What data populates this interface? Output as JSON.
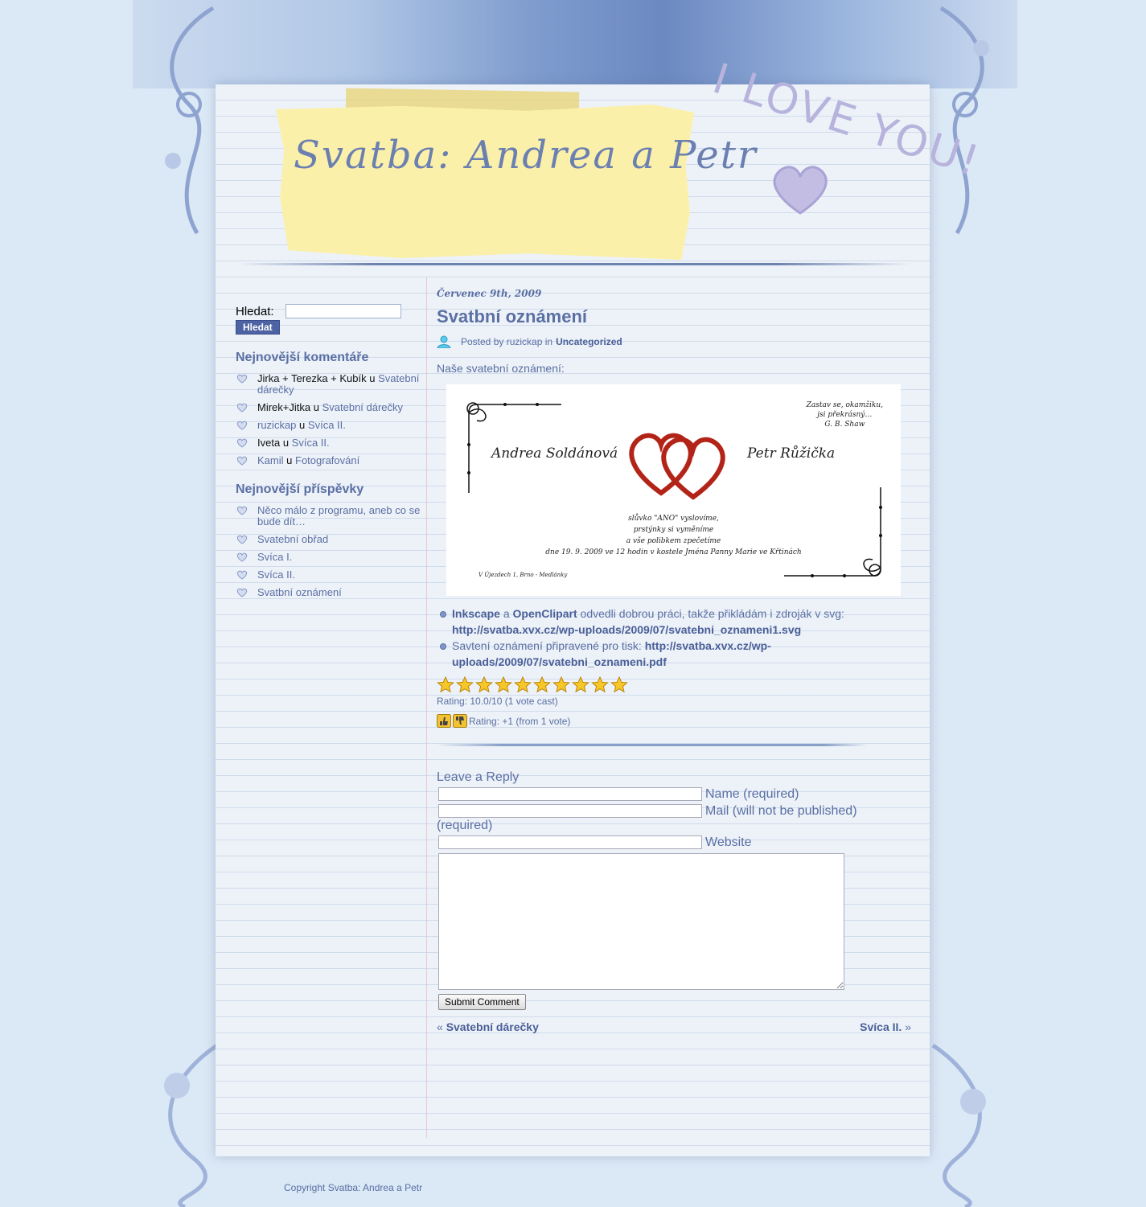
{
  "colors": {
    "accent": "#5a6fa3",
    "button": "#4d63a3",
    "tape": "#fbf0a9",
    "background": "#dbe8f6"
  },
  "header": {
    "site_title": "Svatba: Andrea a Petr",
    "decor_text": "I LOVE YOU!"
  },
  "search": {
    "label": "Hledat:",
    "value": "",
    "button": "Hledat"
  },
  "recent_comments": {
    "title": "Nejnovější komentáře",
    "items": [
      {
        "author": "Jirka + Terezka + Kubík",
        "sep": "u",
        "post": "Svatební dárečky"
      },
      {
        "author": "Mirek+Jitka",
        "sep": "u",
        "post": "Svatební dárečky"
      },
      {
        "author": "ruzickap",
        "sep": "u",
        "post": "Svíca II."
      },
      {
        "author": "Iveta",
        "sep": "u",
        "post": "Svíca II."
      },
      {
        "author": "Kamil",
        "sep": "u",
        "post": "Fotografování"
      }
    ]
  },
  "recent_posts": {
    "title": "Nejnovější příspěvky",
    "items": [
      "Něco málo z programu, aneb co se bude dít…",
      "Svatební obřad",
      "Svíca I.",
      "Svíca II.",
      "Svatbní oznámení"
    ]
  },
  "post": {
    "date": "Červenec 9th, 2009",
    "title": "Svatbní oznámení",
    "posted_by": "Posted by ruzickap in",
    "category": "Uncategorized",
    "intro": "Naše svatební oznámení:",
    "card": {
      "quote_1": "Zastav se, okamžiku,",
      "quote_2": "jsi překrásný…",
      "quote_3": "G. B. Shaw",
      "name_left": "Andrea Soldánová",
      "name_right": "Petr Růžička",
      "vow_1": "slůvko \"ANO\" vyslovíme,",
      "vow_2": "prstýnky si vyměníme",
      "vow_3": "a vše polibkem zpečetíme",
      "vow_4": "dne 19. 9. 2009 ve 12 hodin v kostele Jména Panny Marie ve Křtinách",
      "address": "V Újezdech 1, Brno - Medlánky"
    },
    "bullet_1": {
      "link_a": "Inkscape",
      "and": "a",
      "link_b": "OpenClipart",
      "text": "odvedli dobrou práci, takže přikládám i zdroják v svg:",
      "url": "http://svatba.xvx.cz/wp-uploads/2009/07/svatebni_oznameni1.svg"
    },
    "bullet_2": {
      "text": "Savtení oznámení připravené pro tisk:",
      "url": "http://svatba.xvx.cz/wp-uploads/2009/07/svatebni_oznameni.pdf"
    },
    "stars": 10,
    "rating_text": "Rating: 10.0/10 (1 vote cast)",
    "thumbs_text": "Rating: +1 (from 1 vote)"
  },
  "reply": {
    "title": "Leave a Reply",
    "name_label": "Name (required)",
    "mail_label": "Mail (will not be published)",
    "mail_required": "(required)",
    "website_label": "Website",
    "submit": "Submit Comment"
  },
  "nav": {
    "prev_arrow": "«",
    "prev": "Svatební dárečky",
    "next": "Svíca II.",
    "next_arrow": "»"
  },
  "footer": {
    "copyright": "Copyright Svatba: Andrea a Petr"
  }
}
